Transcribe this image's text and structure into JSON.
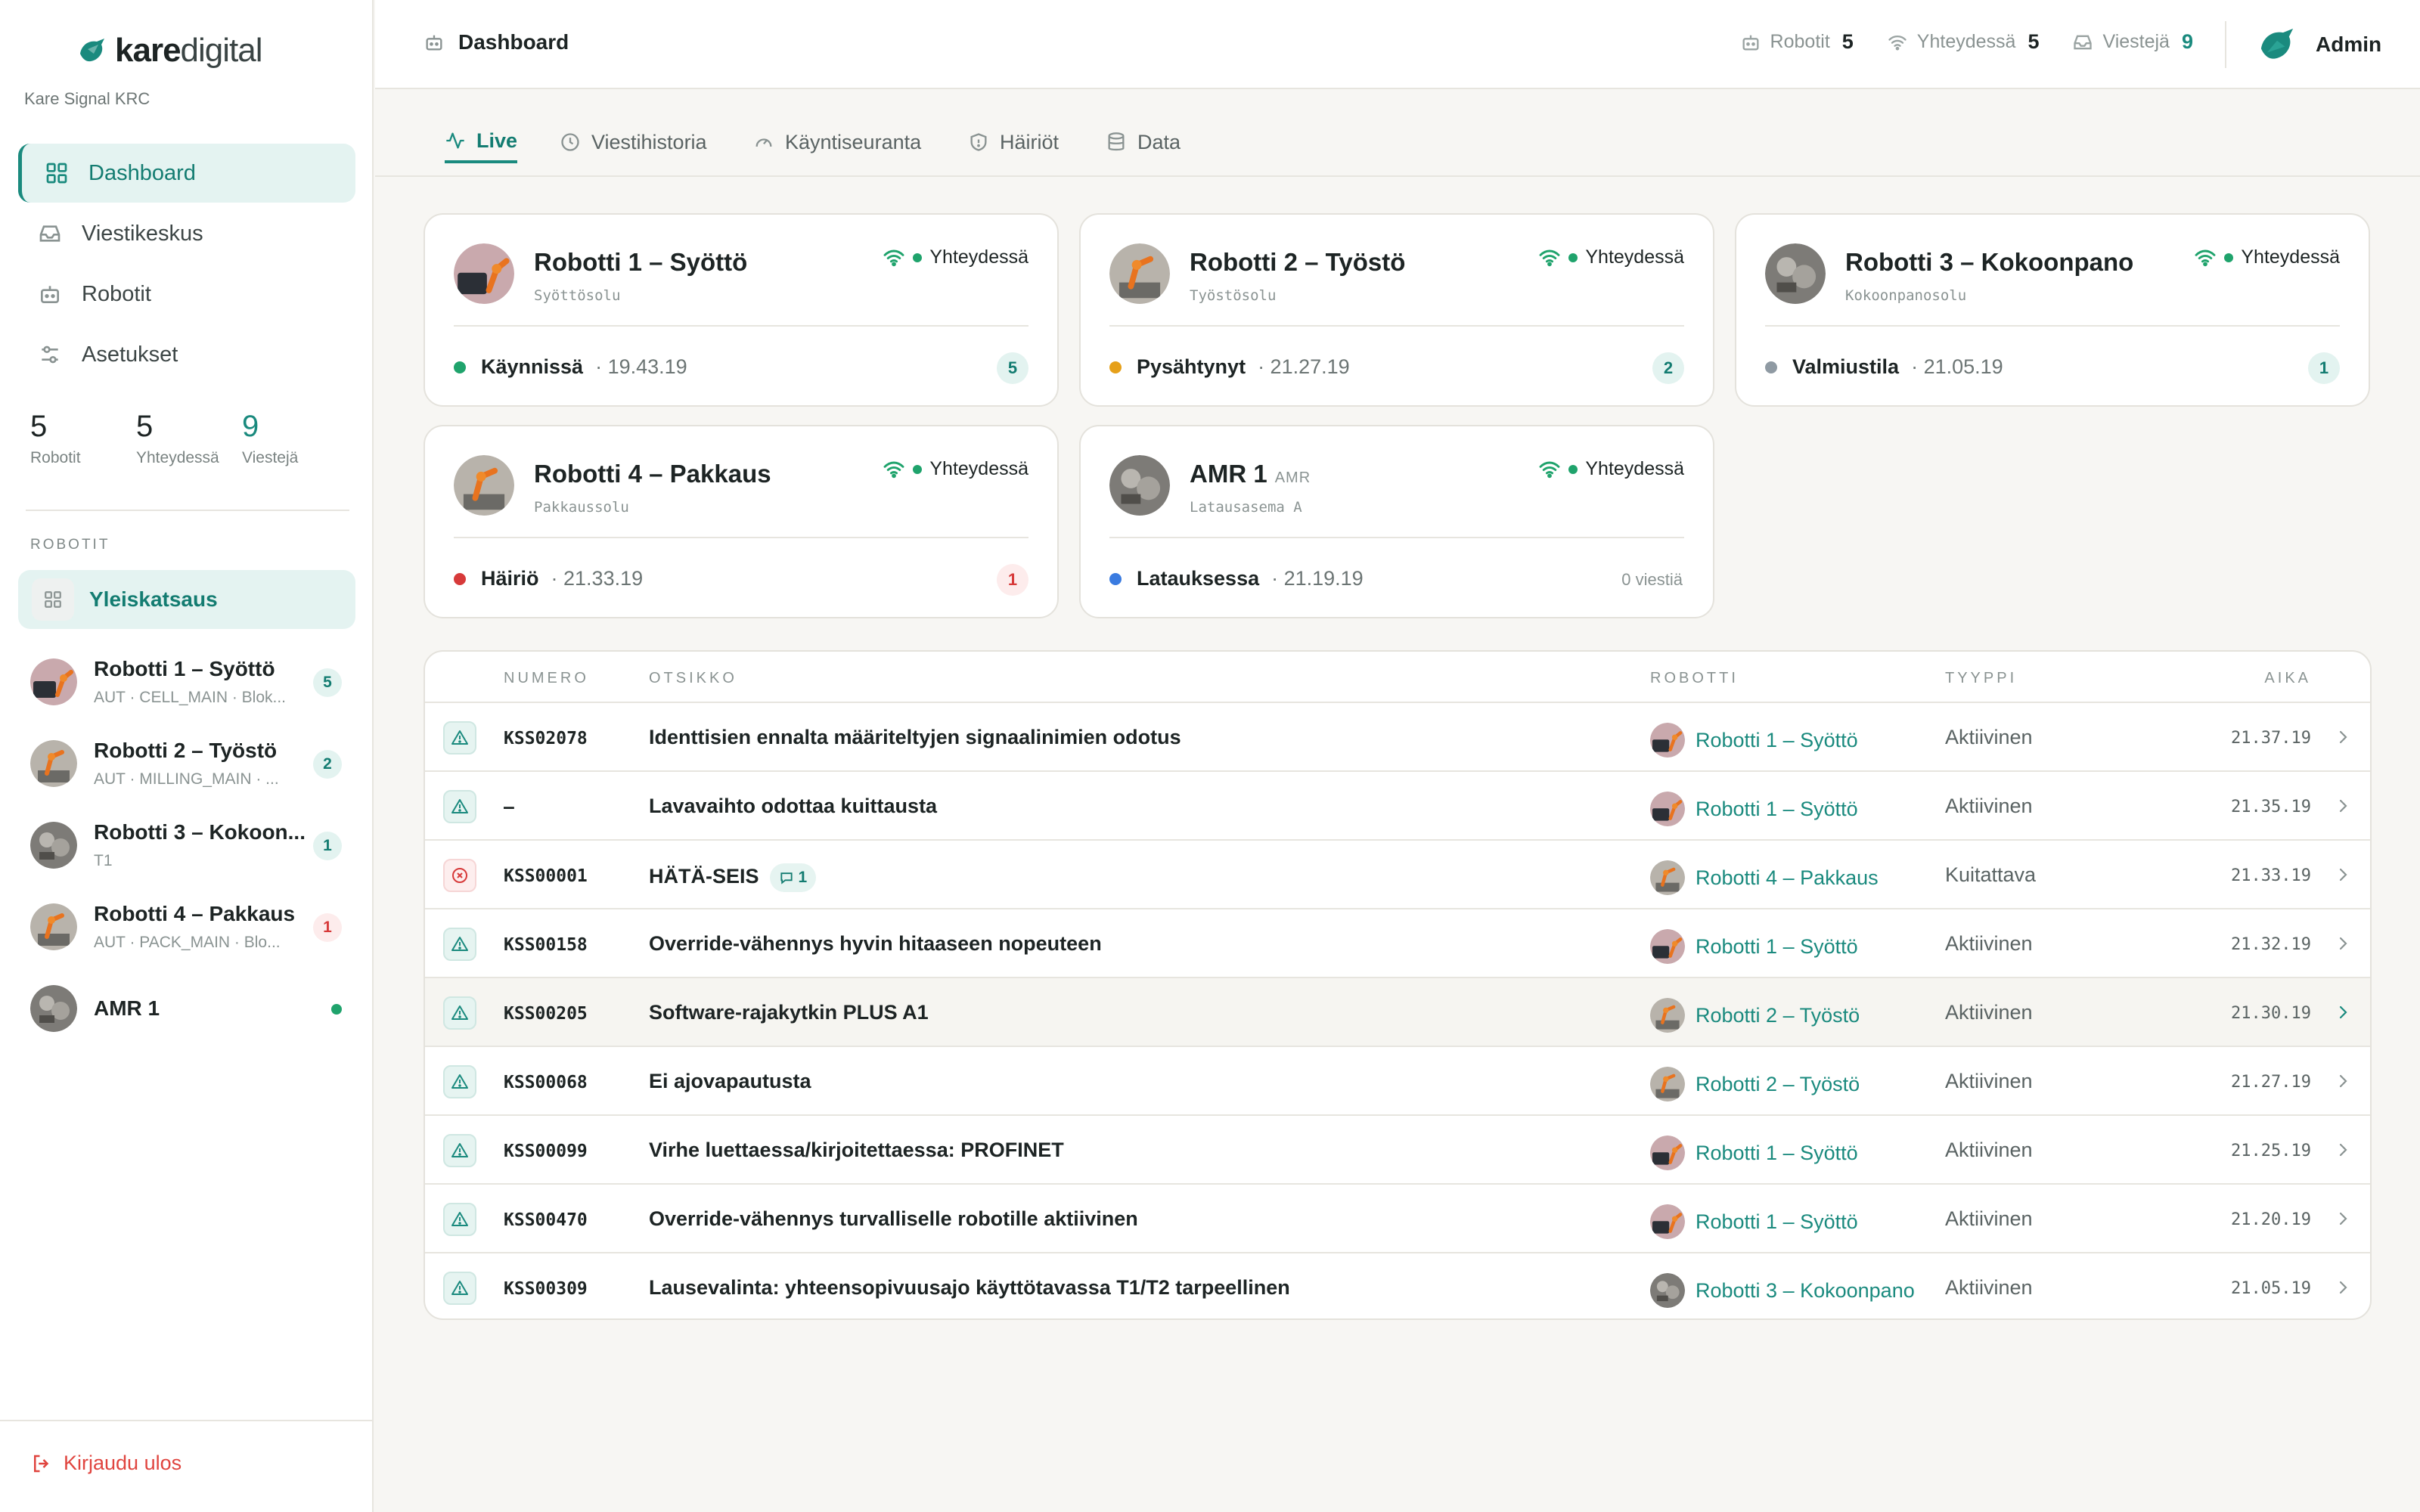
{
  "brand": {
    "word_bold": "kare",
    "word_light": "digital",
    "org": "Kare Signal KRC"
  },
  "nav": [
    {
      "label": "Dashboard",
      "icon": "grid-icon",
      "active": true
    },
    {
      "label": "Viestikeskus",
      "icon": "inbox-icon"
    },
    {
      "label": "Robotit",
      "icon": "robot-icon"
    },
    {
      "label": "Asetukset",
      "icon": "sliders-icon"
    }
  ],
  "sidebar_stats": [
    {
      "value": "5",
      "label": "Robotit"
    },
    {
      "value": "5",
      "label": "Yhteydessä"
    },
    {
      "value": "9",
      "label": "Viestejä"
    }
  ],
  "section_label": "ROBOTIT",
  "overview_label": "Yleiskatsaus",
  "robot_list": [
    {
      "name": "Robotti 1 – Syöttö",
      "sub": "AUT · CELL_MAIN · Blok...",
      "badge": "5"
    },
    {
      "name": "Robotti 2 – Työstö",
      "sub": "AUT · MILLING_MAIN · ...",
      "badge": "2"
    },
    {
      "name": "Robotti 3 – Kokoon...",
      "sub": "T1",
      "badge": "1"
    },
    {
      "name": "Robotti 4 – Pakkaus",
      "sub": "AUT · PACK_MAIN · Blo...",
      "badge": "1"
    },
    {
      "name": "AMR 1",
      "sub": "",
      "badge": ""
    }
  ],
  "logout_label": "Kirjaudu ulos",
  "topbar": {
    "breadcrumb": "Dashboard",
    "stats": [
      {
        "label": "Robotit",
        "value": "5",
        "icon": "robot-icon"
      },
      {
        "label": "Yhteydessä",
        "value": "5",
        "icon": "wifi-icon"
      },
      {
        "label": "Viestejä",
        "value": "9",
        "icon": "inbox-icon"
      }
    ],
    "user": "Admin"
  },
  "tabs": [
    {
      "label": "Live",
      "icon": "activity-icon",
      "active": true
    },
    {
      "label": "Viestihistoria",
      "icon": "clock-icon"
    },
    {
      "label": "Käyntiseuranta",
      "icon": "gauge-icon"
    },
    {
      "label": "Häiriöt",
      "icon": "shield-icon"
    },
    {
      "label": "Data",
      "icon": "database-icon"
    }
  ],
  "cards": [
    {
      "title": "Robotti 1 – Syöttö",
      "tag": "",
      "subtitle": "Syöttösolu",
      "connection": "Yhteydessä",
      "status": "Käynnissä",
      "status_color": "#1fa36c",
      "time": "· 19.43.19",
      "count": "5",
      "count_text": ""
    },
    {
      "title": "Robotti 2 – Työstö",
      "tag": "",
      "subtitle": "Työstösolu",
      "connection": "Yhteydessä",
      "status": "Pysähtynyt",
      "status_color": "#e6a01a",
      "time": "· 21.27.19",
      "count": "2",
      "count_text": ""
    },
    {
      "title": "Robotti 3 – Kokoonpano",
      "tag": "",
      "subtitle": "Kokoonpanosolu",
      "connection": "Yhteydessä",
      "status": "Valmiustila",
      "status_color": "#8f9aa3",
      "time": "· 21.05.19",
      "count": "1",
      "count_text": ""
    },
    {
      "title": "Robotti 4 – Pakkaus",
      "tag": "",
      "subtitle": "Pakkaussolu",
      "connection": "Yhteydessä",
      "status": "Häiriö",
      "status_color": "#d73a3a",
      "time": "· 21.33.19",
      "count": "1",
      "count_text": ""
    },
    {
      "title": "AMR 1",
      "tag": "AMR",
      "subtitle": "Latausasema A",
      "connection": "Yhteydessä",
      "status": "Latauksessa",
      "status_color": "#3a7be0",
      "time": "· 21.19.19",
      "count": "",
      "count_text": "0 viestiä"
    }
  ],
  "table": {
    "headers": {
      "number": "NUMERO",
      "title": "OTSIKKO",
      "robot": "ROBOTTI",
      "type": "TYYPPI",
      "time": "AIKA"
    },
    "rows": [
      {
        "kind": "warn",
        "number": "KSS02078",
        "title": "Identtisien ennalta määriteltyjen signaalinimien odotus",
        "comments": "",
        "robot": "Robotti 1 – Syöttö",
        "type": "Aktiivinen",
        "time": "21.37.19"
      },
      {
        "kind": "warn",
        "number": "–",
        "title": "Lavavaihto odottaa kuittausta",
        "comments": "",
        "robot": "Robotti 1 – Syöttö",
        "type": "Aktiivinen",
        "time": "21.35.19"
      },
      {
        "kind": "err",
        "number": "KSS00001",
        "title": "HÄTÄ-SEIS",
        "comments": "1",
        "robot": "Robotti 4 – Pakkaus",
        "type": "Kuitattava",
        "time": "21.33.19"
      },
      {
        "kind": "warn",
        "number": "KSS00158",
        "title": "Override-vähennys hyvin hitaaseen nopeuteen",
        "comments": "",
        "robot": "Robotti 1 – Syöttö",
        "type": "Aktiivinen",
        "time": "21.32.19"
      },
      {
        "kind": "warn",
        "number": "KSS00205",
        "title": "Software-rajakytkin PLUS A1",
        "comments": "",
        "robot": "Robotti 2 – Työstö",
        "type": "Aktiivinen",
        "time": "21.30.19"
      },
      {
        "kind": "warn",
        "number": "KSS00068",
        "title": "Ei ajovapautusta",
        "comments": "",
        "robot": "Robotti 2 – Työstö",
        "type": "Aktiivinen",
        "time": "21.27.19"
      },
      {
        "kind": "warn",
        "number": "KSS00099",
        "title": "Virhe luettaessa/kirjoitettaessa: PROFINET",
        "comments": "",
        "robot": "Robotti 1 – Syöttö",
        "type": "Aktiivinen",
        "time": "21.25.19"
      },
      {
        "kind": "warn",
        "number": "KSS00470",
        "title": "Override-vähennys turvalliselle robotille aktiivinen",
        "comments": "",
        "robot": "Robotti 1 – Syöttö",
        "type": "Aktiivinen",
        "time": "21.20.19"
      },
      {
        "kind": "warn",
        "number": "KSS00309",
        "title": "Lausevalinta: yhteensopivuusajo käyttötavassa T1/T2 tarpeellinen",
        "comments": "",
        "robot": "Robotti 3 – Kokoonpano",
        "type": "Aktiivinen",
        "time": "21.05.19"
      }
    ]
  }
}
